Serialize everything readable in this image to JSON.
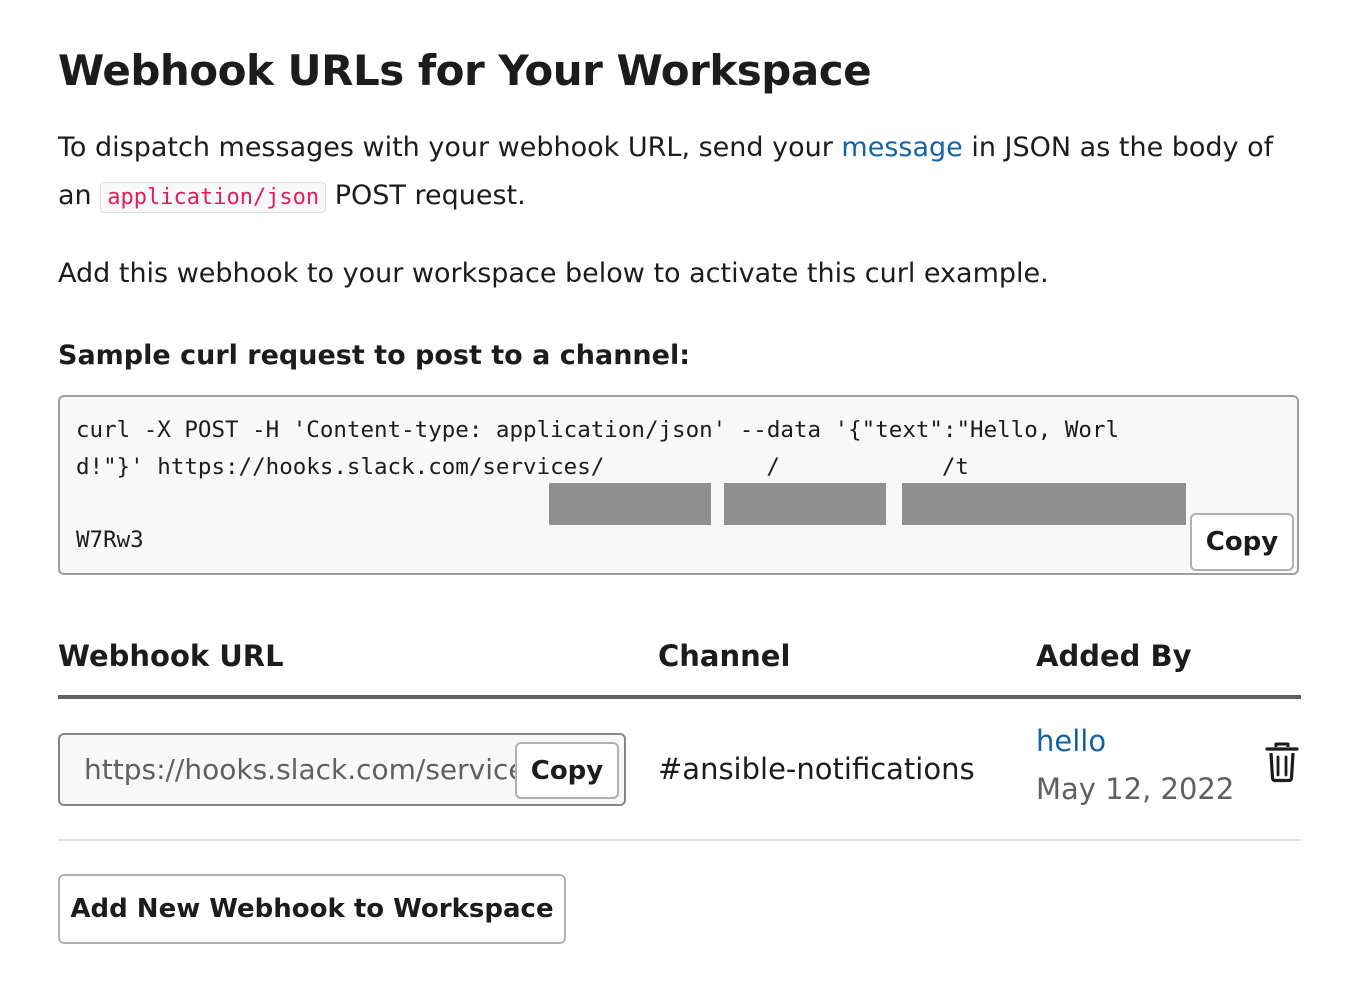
{
  "page": {
    "title": "Webhook URLs for Your Workspace",
    "intro": {
      "before_link": "To dispatch messages with your webhook URL, send your ",
      "link": "message",
      "after_link": " in JSON as the body of an ",
      "code": "application/json",
      "after_code": " POST request."
    },
    "activate_text": "Add this webhook to your workspace below to activate this curl example."
  },
  "sample": {
    "heading": "Sample curl request to post to a channel:",
    "command": "curl -X POST -H 'Content-type: application/json' --data '{\"text\":\"Hello, World!\"}' https://hooks.slack.com/services/",
    "sep1": "/",
    "sep2": "/",
    "sep3": "t",
    "tail": "W7Rw3",
    "copy_label": "Copy"
  },
  "table": {
    "headers": {
      "url": "Webhook URL",
      "channel": "Channel",
      "added_by": "Added By"
    },
    "rows": [
      {
        "url_value": "https://hooks.slack.com/services",
        "copy_label": "Copy",
        "channel": "#ansible-notifications",
        "added_by": "hello",
        "date": "May 12, 2022",
        "delete_icon": "trash-icon"
      }
    ]
  },
  "actions": {
    "add_label": "Add New Webhook to Workspace"
  },
  "colors": {
    "link": "#1264a3",
    "code": "#e01e5a",
    "text": "#1d1c1d",
    "muted": "#616061",
    "redaction": "#8f8f8f"
  }
}
